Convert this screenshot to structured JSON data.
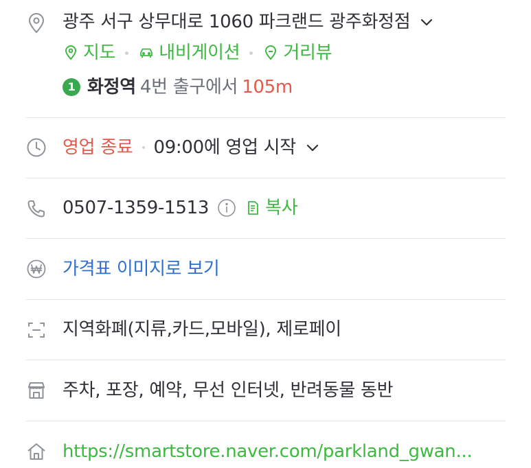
{
  "address": {
    "text": "광주 서구 상무대로 1060 파크랜드 광주화정점",
    "links": {
      "map": "지도",
      "navigation": "내비게이션",
      "street_view": "거리뷰"
    },
    "subway": {
      "line": "1",
      "station": "화정역",
      "exit_text": "4번 출구에서",
      "distance": "105m"
    }
  },
  "hours": {
    "status": "영업 종료",
    "next": "09:00에 영업 시작"
  },
  "phone": {
    "number": "0507-1359-1513",
    "copy_label": "복사"
  },
  "price": {
    "label": "가격표 이미지로 보기"
  },
  "payment": {
    "text": "지역화폐(지류,카드,모바일), 제로페이"
  },
  "amenities": {
    "text": "주차, 포장, 예약, 무선 인터넷, 반려동물 동반"
  },
  "homepage": {
    "url": "https://smartstore.naver.com/parkland_gwan..."
  },
  "colors": {
    "green": "#3fb843",
    "red": "#e25a4b",
    "blue": "#2e6fcf",
    "subway_line_1": "#3aa84f"
  }
}
